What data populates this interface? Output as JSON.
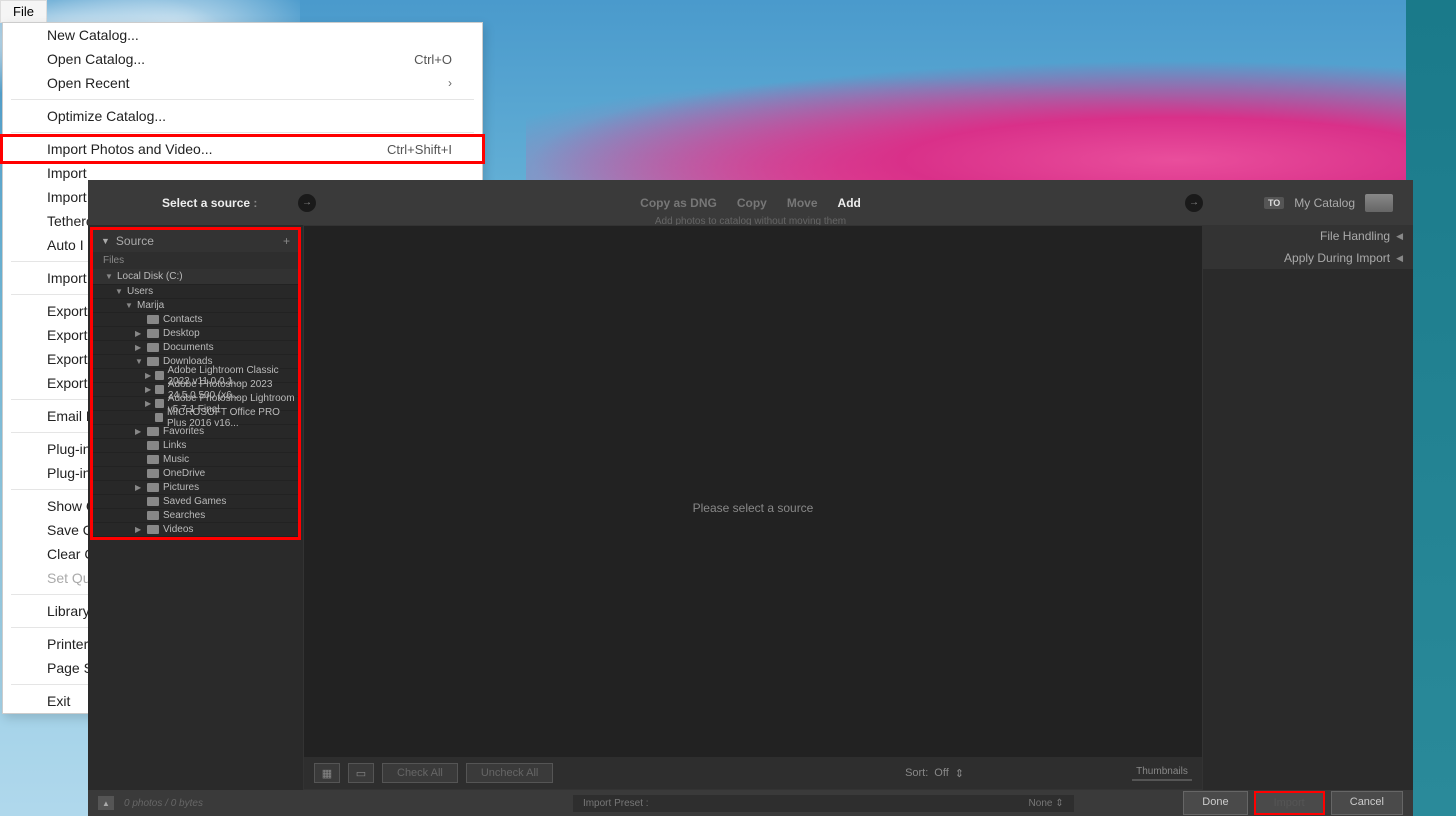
{
  "file_tab": "File",
  "menu": {
    "new_catalog": "New Catalog...",
    "open_catalog": "Open Catalog...",
    "open_catalog_shortcut": "Ctrl+O",
    "open_recent": "Open Recent",
    "optimize_catalog": "Optimize Catalog...",
    "import_photos": "Import Photos and Video...",
    "import_photos_shortcut": "Ctrl+Shift+I",
    "import_a": "Import",
    "import_b": "Import",
    "tethered": "Tethere",
    "auto_import": "Auto I",
    "import_c": "Import",
    "export_a": "Export.",
    "export_b": "Export",
    "export_c": "Export",
    "export_d": "Export",
    "email": "Email P",
    "plugin_a": "Plug-in",
    "plugin_b": "Plug-in",
    "show_q": "Show C",
    "save_q": "Save Q",
    "clear_q": "Clear C",
    "set_q": "Set Qu",
    "library": "Library",
    "printer": "Printer.",
    "page_setup": "Page Se",
    "exit": "Exit"
  },
  "import": {
    "select_source": "Select a source",
    "modes": {
      "copy_dng": "Copy as DNG",
      "copy": "Copy",
      "move": "Move",
      "add": "Add"
    },
    "mode_subtitle": "Add photos to catalog without moving them",
    "to_badge": "TO",
    "my_catalog": "My Catalog",
    "source_panel": "Source",
    "files_label": "Files",
    "tree": {
      "local_disk": "Local Disk (C:)",
      "users": "Users",
      "user_name": "Marija",
      "contacts": "Contacts",
      "desktop": "Desktop",
      "documents": "Documents",
      "downloads": "Downloads",
      "dl1": "Adobe Lightroom Classic 2022 v11.0.0.1...",
      "dl2": "Adobe Photoshop 2023 24.5.0.500 (x6...",
      "dl3": "Adobe Photoshop Lightroom v5.7.1 Final",
      "dl4": "MICROSOFT Office PRO Plus 2016 v16...",
      "favorites": "Favorites",
      "links": "Links",
      "music": "Music",
      "onedrive": "OneDrive",
      "pictures": "Pictures",
      "saved_games": "Saved Games",
      "searches": "Searches",
      "videos": "Videos"
    },
    "center_msg": "Please select a source",
    "right": {
      "file_handling": "File Handling",
      "apply_during": "Apply During Import"
    },
    "center_bottom": {
      "check_all": "Check All",
      "uncheck_all": "Uncheck All",
      "sort_label": "Sort:",
      "sort_value": "Off",
      "thumbnails": "Thumbnails"
    },
    "bottom": {
      "count": "0 photos / 0 bytes",
      "preset_label": "Import Preset :",
      "preset_value": "None",
      "done": "Done",
      "import": "Import",
      "cancel": "Cancel"
    }
  }
}
